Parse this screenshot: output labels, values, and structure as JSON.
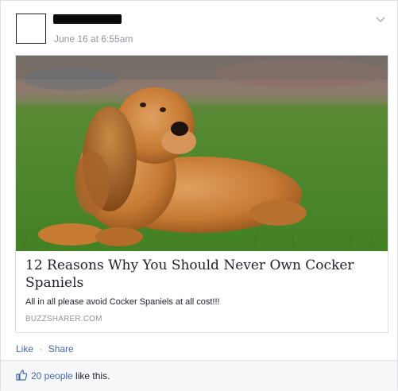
{
  "post": {
    "timestamp": "June 16 at 6:55am"
  },
  "icons": {
    "menu": "chevron-down-icon",
    "like": "thumbs-up-icon"
  },
  "link_card": {
    "title": "12 Reasons Why You Should Never Own Cocker Spaniels",
    "description": "All in all please avoid Cocker Spaniels at all cost!!!",
    "domain": "BUZZSHARER.COM"
  },
  "actions": {
    "like_label": "Like",
    "separator": "·",
    "share_label": "Share"
  },
  "likes": {
    "count_label": "20 people",
    "suffix": " like this."
  },
  "colors": {
    "link_blue": "#4267b2",
    "meta_gray": "#90949c",
    "grass_green": "#4f8a2a",
    "dog_orange": "#c97a35"
  }
}
